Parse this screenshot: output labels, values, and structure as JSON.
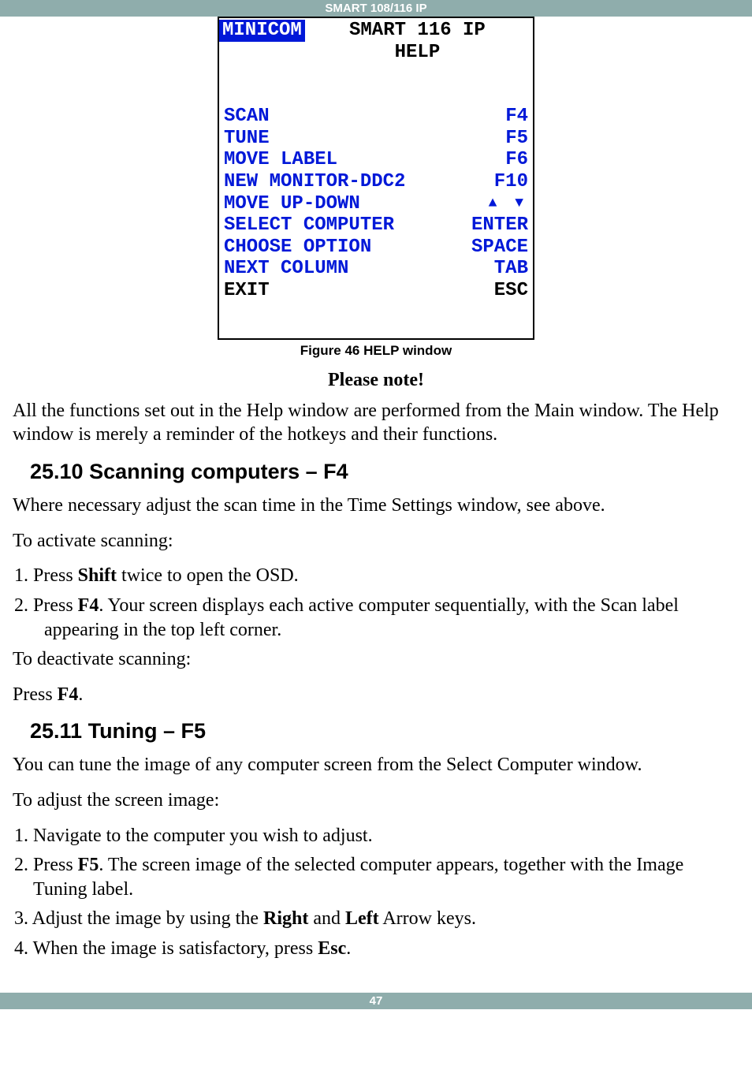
{
  "header_bar": "SMART 108/116 IP",
  "help_window": {
    "brand": "MINICOM",
    "title": "SMART 116 IP",
    "subtitle": "HELP",
    "rows": [
      {
        "label": "SCAN",
        "key": "F4"
      },
      {
        "label": "TUNE",
        "key": "F5"
      },
      {
        "label": "MOVE LABEL",
        "key": "F6"
      },
      {
        "label": "NEW MONITOR-DDC2",
        "key": "F10"
      },
      {
        "label": "MOVE UP-DOWN",
        "key": "▲ ▼"
      },
      {
        "label": "SELECT COMPUTER",
        "key": "ENTER"
      },
      {
        "label": "CHOOSE OPTION",
        "key": "SPACE"
      },
      {
        "label": "NEXT COLUMN",
        "key": "TAB"
      }
    ],
    "exit_row": {
      "label": "EXIT",
      "key": "ESC"
    }
  },
  "figure_caption": "Figure 46 HELP window",
  "note_heading": "Please note!",
  "note_para": "All the functions set out in the Help window are performed from the Main window. The Help window is merely a reminder of the hotkeys and their functions.",
  "section_2510": {
    "heading": "25.10 Scanning computers – F4",
    "p1": "Where necessary adjust the scan time in the Time Settings window, see above.",
    "p2": "To activate scanning:",
    "li1_pre": "1.  Press ",
    "li1_b": "Shift",
    "li1_post": " twice to open the OSD.",
    "li2_pre": "2.  Press ",
    "li2_b": "F4",
    "li2_post": ". Your screen displays each active computer sequentially, with the Scan label appearing in the top left corner.",
    "p3": "To deactivate scanning:",
    "p4_pre": "Press ",
    "p4_b": "F4",
    "p4_post": "."
  },
  "section_2511": {
    "heading": "25.11 Tuning – F5",
    "p1": "You can tune the image of any computer screen from the Select Computer window.",
    "p2": "To adjust the screen image:",
    "li1": "1. Navigate to the computer you wish to adjust.",
    "li2_pre": "2. Press ",
    "li2_b": "F5",
    "li2_post": ". The screen image of the selected computer appears, together with the Image Tuning label.",
    "li3_pre": "3. Adjust the image by using the ",
    "li3_b1": "Right",
    "li3_mid": " and ",
    "li3_b2": "Left",
    "li3_post": " Arrow keys.",
    "li4_pre": "4. When the image is satisfactory, press ",
    "li4_b": "Esc",
    "li4_post": "."
  },
  "page_number": "47"
}
